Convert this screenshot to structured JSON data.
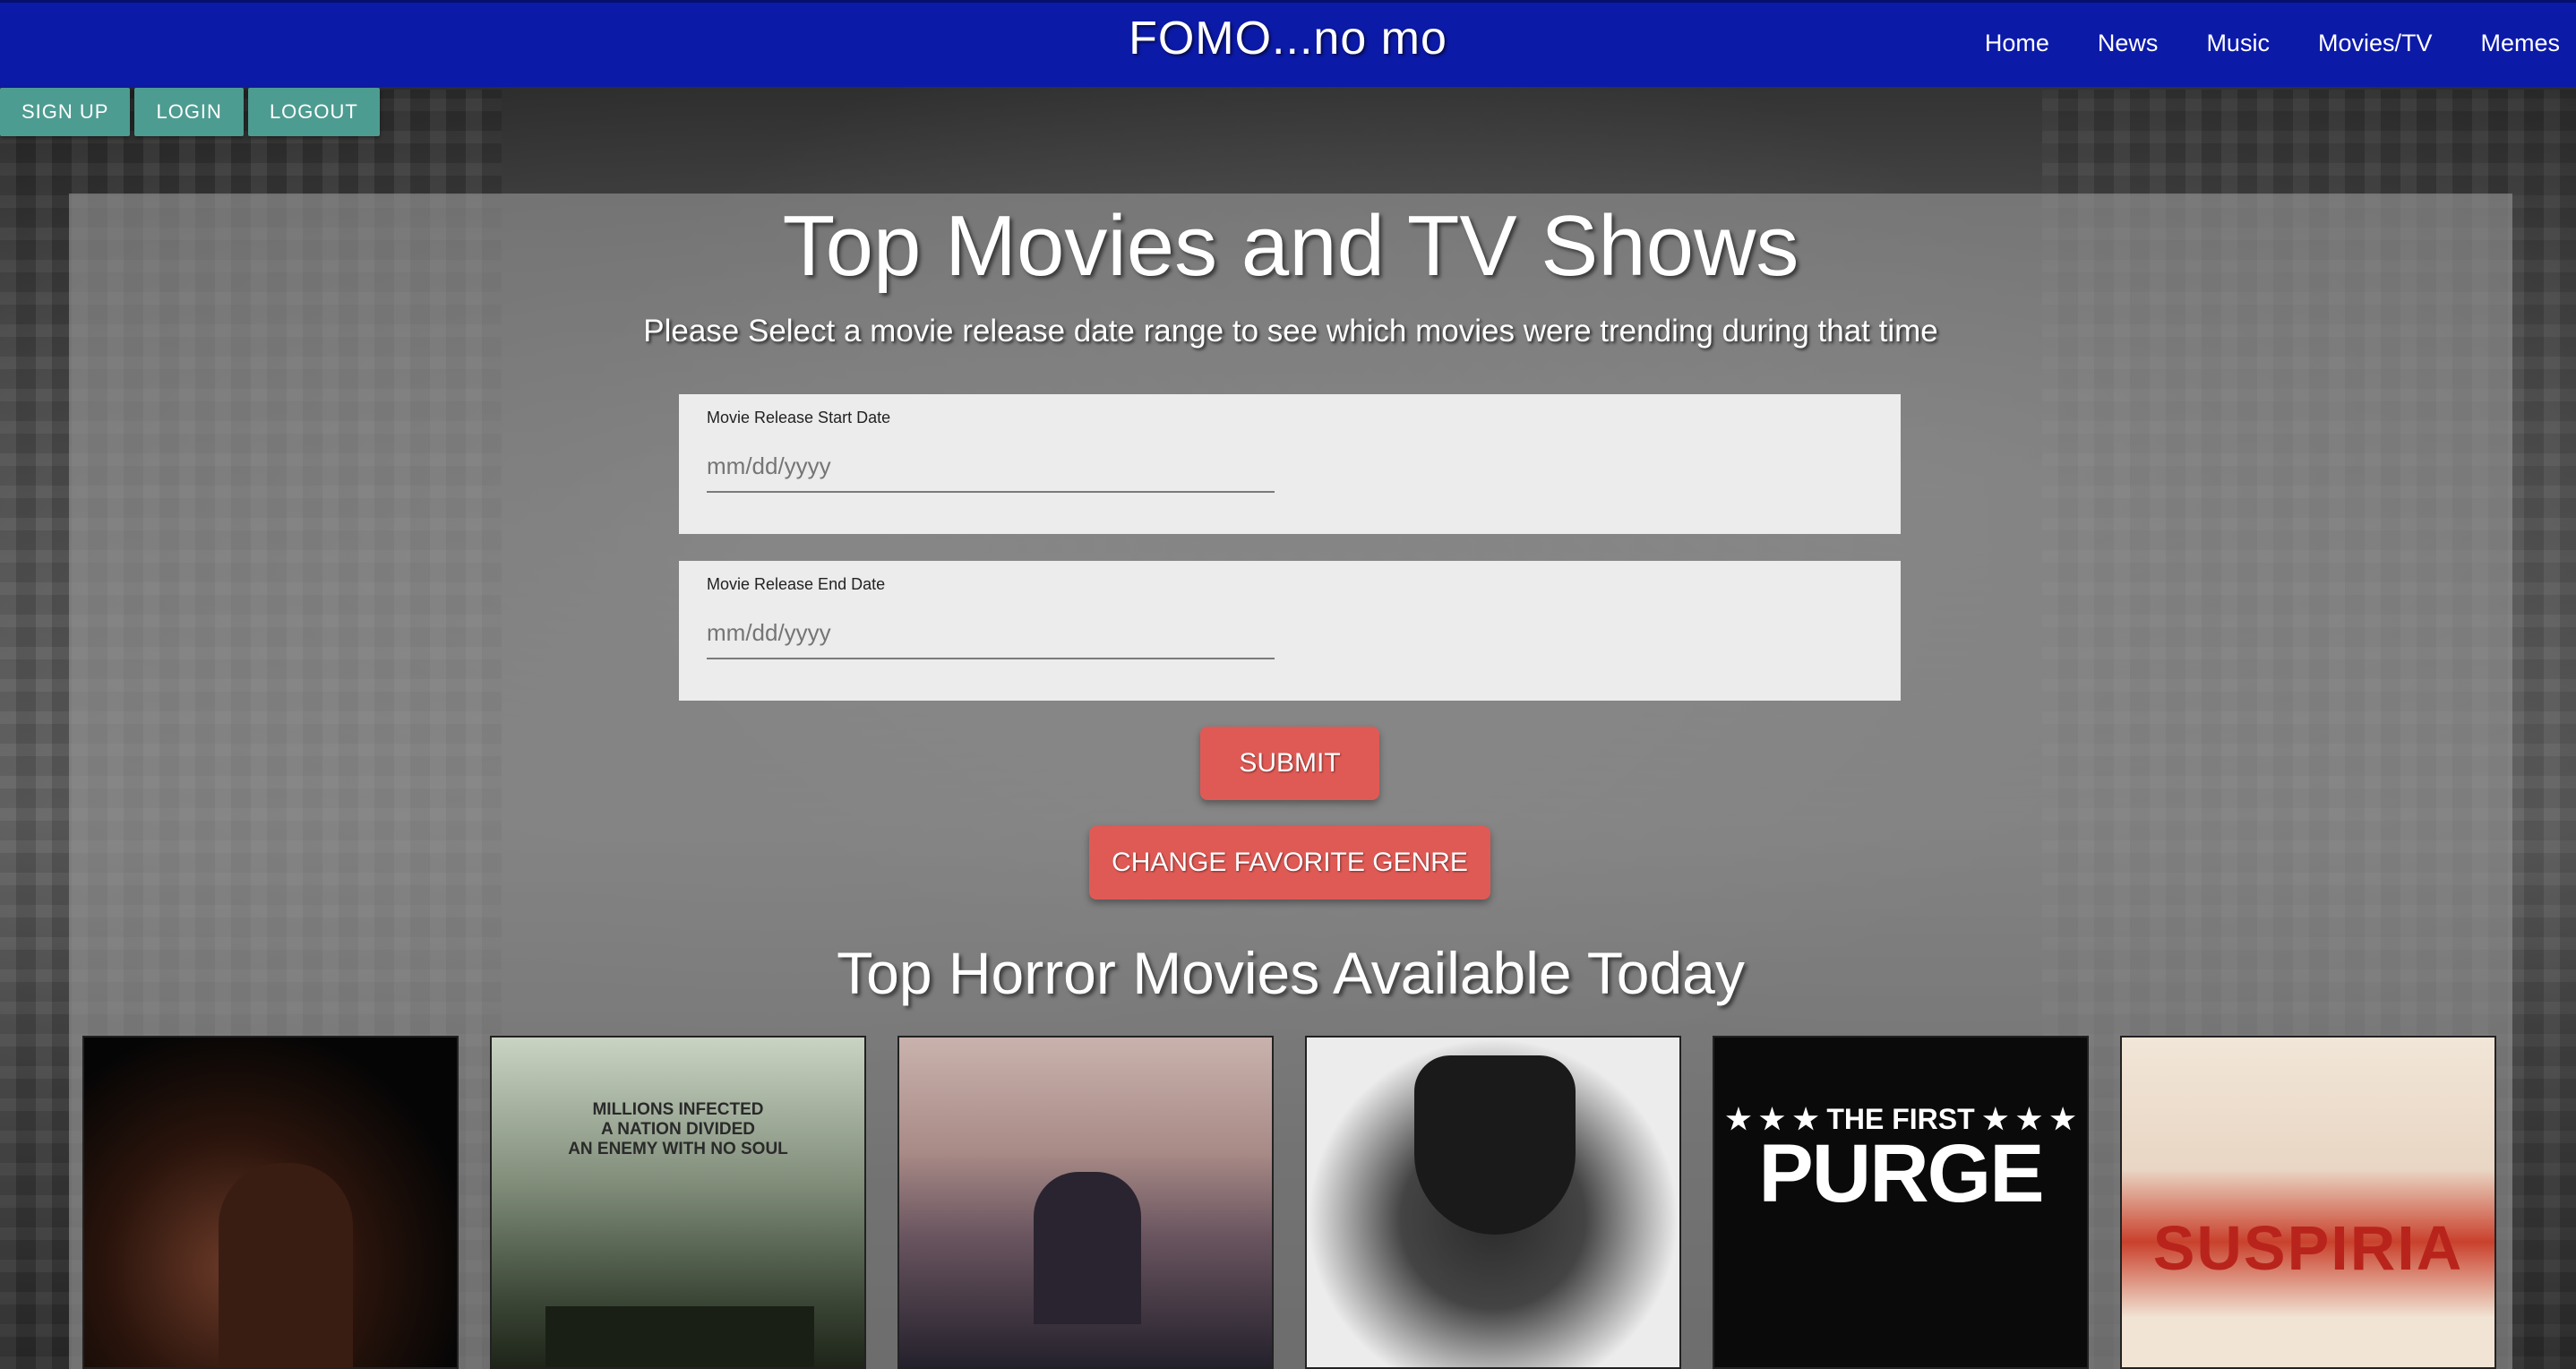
{
  "header": {
    "brand": "FOMO...no mo",
    "nav": [
      "Home",
      "News",
      "Music",
      "Movies/TV",
      "Memes"
    ]
  },
  "auth": {
    "signup": "SIGN UP",
    "login": "LOGIN",
    "logout": "LOGOUT"
  },
  "main": {
    "title": "Top Movies and TV Shows",
    "subtitle": "Please Select a movie release date range to see which movies were trending during that time",
    "start_date": {
      "label": "Movie Release Start Date",
      "placeholder": "mm/dd/yyyy"
    },
    "end_date": {
      "label": "Movie Release End Date",
      "placeholder": "mm/dd/yyyy"
    },
    "submit_label": "SUBMIT",
    "genre_label": "CHANGE FAVORITE GENRE",
    "section_title": "Top Horror Movies Available Today"
  },
  "posters": [
    {
      "text": ""
    },
    {
      "text": "MILLIONS INFECTED\nA NATION DIVIDED\nAN ENEMY WITH NO SOUL"
    },
    {
      "text": ""
    },
    {
      "text": ""
    },
    {
      "text_top": "★ ★ ★ THE FIRST ★ ★ ★",
      "text_main": "PURGE"
    },
    {
      "text": "SUSPIRIA"
    }
  ],
  "colors": {
    "header_bg": "#0c1aa8",
    "auth_button": "#4d9c91",
    "action_button": "#e05a55"
  }
}
